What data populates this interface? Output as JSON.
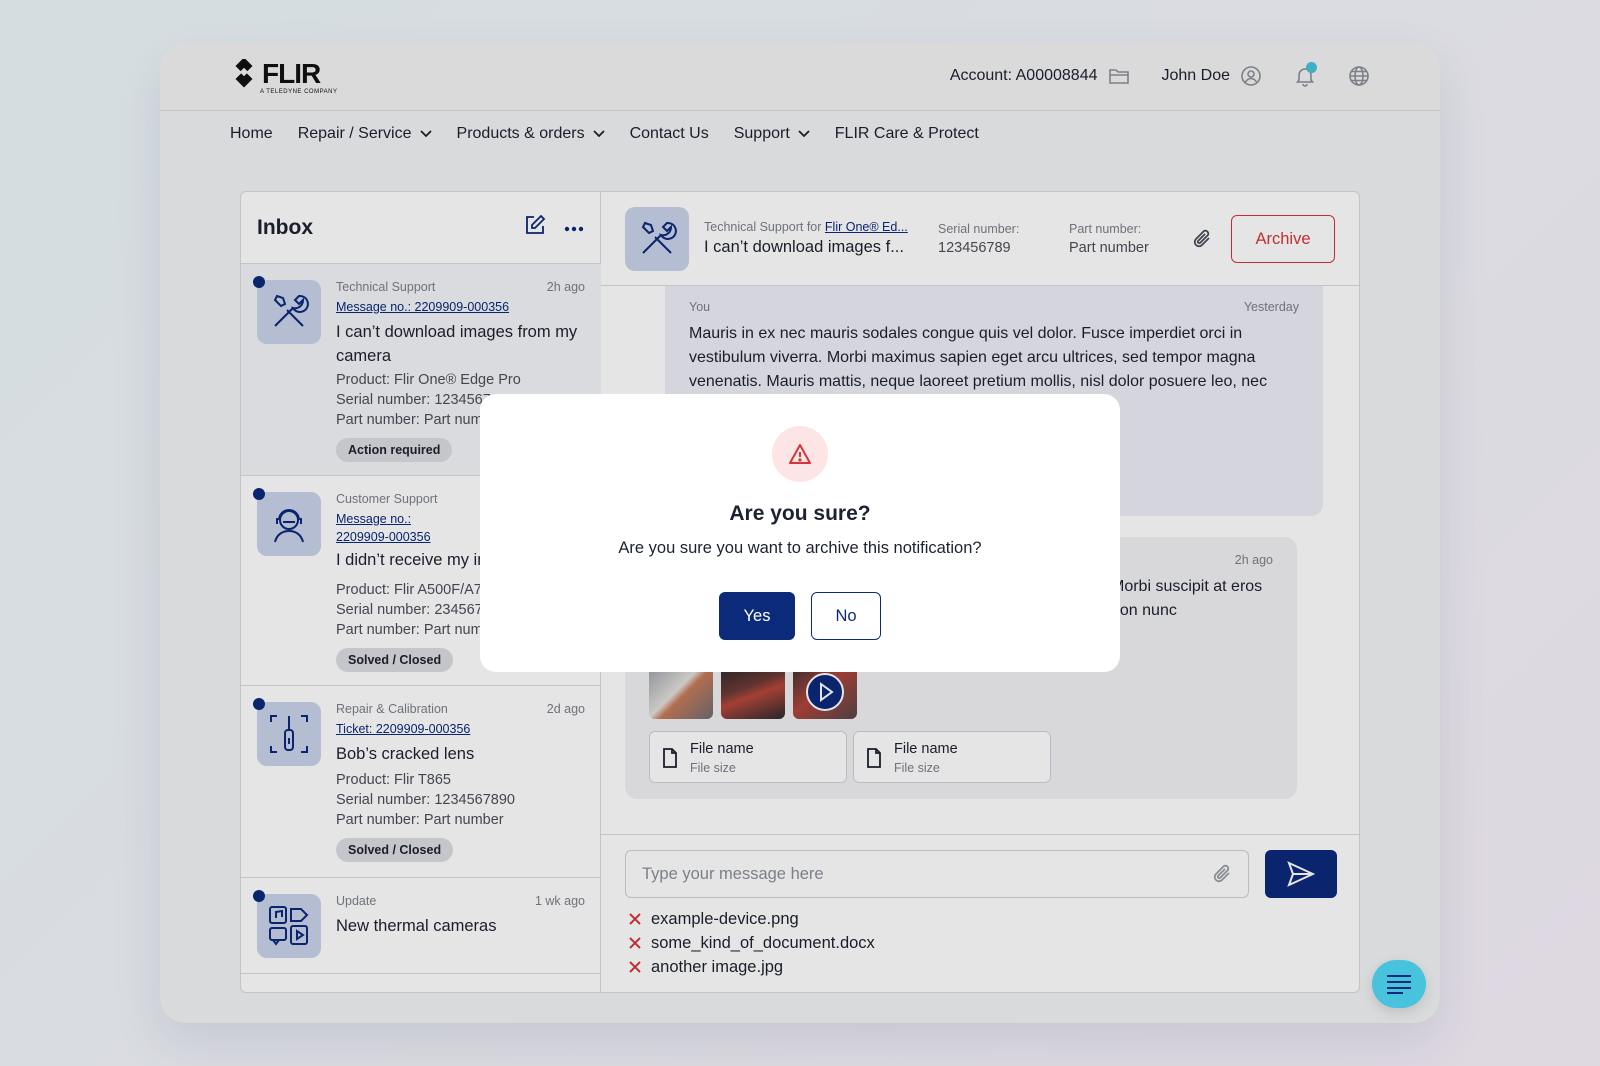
{
  "brand": {
    "name": "FLIR",
    "tagline": "A TELEDYNE COMPANY"
  },
  "header": {
    "account_label": "Account: A00008844",
    "user_name": "John Doe"
  },
  "nav": {
    "items": [
      {
        "label": "Home",
        "dropdown": false
      },
      {
        "label": "Repair / Service",
        "dropdown": true
      },
      {
        "label": "Products & orders",
        "dropdown": true
      },
      {
        "label": "Contact Us",
        "dropdown": false
      },
      {
        "label": "Support",
        "dropdown": true
      },
      {
        "label": "FLIR Care & Protect",
        "dropdown": false
      }
    ]
  },
  "inbox": {
    "title": "Inbox",
    "messages": [
      {
        "category": "Technical Support",
        "time": "2h ago",
        "ref": "Message no.: 2209909-000356",
        "subject": "I can’t download images from my camera",
        "product": "Product: Flir One® Edge Pro",
        "serial": "Serial number: 1234567890",
        "part": "Part number: Part number",
        "status": "Action required",
        "icon": "tools-icon"
      },
      {
        "category": "Customer Support",
        "time": "",
        "ref": "Message no.: 2209909-000356",
        "subject": "I didn’t receive my invoice",
        "product": "Product: Flir A500F/A700F",
        "serial": "Serial number: 2345678901",
        "part": "Part number: Part number",
        "status": "Solved / Closed",
        "icon": "support-agent-icon"
      },
      {
        "category": "Repair & Calibration",
        "time": "2d ago",
        "ref": "Ticket: 2209909-000356",
        "subject": "Bob’s cracked lens",
        "product": "Product: Flir T865",
        "serial": "Serial number: 1234567890",
        "part": "Part number: Part number",
        "status": "Solved / Closed",
        "icon": "calibration-icon"
      },
      {
        "category": "Update",
        "time": "1 wk ago",
        "ref": "",
        "subject": "New thermal cameras",
        "icon": "media-icon"
      }
    ]
  },
  "conversation": {
    "category_prefix": "Technical Support for",
    "category_link": "Flir One® Ed...",
    "subject": "I can’t download images f...",
    "serial_label": "Serial number:",
    "serial_value": "123456789",
    "part_label": "Part number:",
    "part_value": "Part number",
    "archive_label": "Archive",
    "my_message": {
      "author": "You",
      "time": "Yesterday",
      "text": "Mauris in ex nec mauris sodales congue quis vel dolor. Fusce imperdiet orci in vestibulum viverra. Morbi maximus sapien eget arcu ultrices, sed tempor magna venenatis. Mauris mattis, neque laoreet pretium mollis, nisl dolor posuere leo, nec suscipit ullamcorper. sollicitudin neque."
    },
    "reply": {
      "time": "2h ago",
      "text": "Morbi suscipit at eros non nunc",
      "files": [
        {
          "name": "File name",
          "size": "File size"
        },
        {
          "name": "File name",
          "size": "File size"
        }
      ]
    },
    "composer": {
      "placeholder": "Type your message here",
      "attachments": [
        "example-device.png",
        "some_kind_of_document.docx",
        "another image.jpg"
      ]
    }
  },
  "modal": {
    "title": "Are you sure?",
    "message": "Are you sure you want to archive this notification?",
    "yes_label": "Yes",
    "no_label": "No"
  },
  "colors": {
    "brand_blue": "#0c2a7a",
    "danger": "#d5353a",
    "notification_dot": "#47c3dd",
    "avatar_bg": "#c9d3ea"
  }
}
